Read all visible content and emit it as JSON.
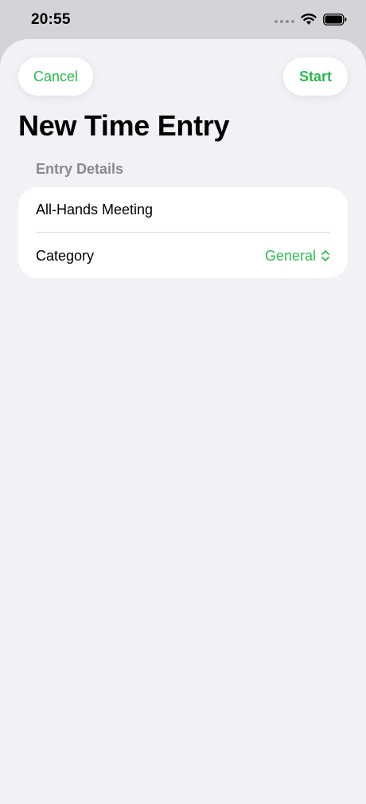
{
  "status_bar": {
    "time": "20:55",
    "icons": [
      "signal-dots-icon",
      "wifi-icon",
      "battery-icon"
    ]
  },
  "toolbar": {
    "cancel_label": "Cancel",
    "start_label": "Start"
  },
  "title": "New Time Entry",
  "section": {
    "header": "Entry Details",
    "name_value": "All-Hands Meeting",
    "category_label": "Category",
    "category_value": "General"
  },
  "colors": {
    "accent": "#2fb94f",
    "background": "#f1f1f6",
    "card": "#ffffff",
    "secondary_text": "#8a8a8e"
  }
}
